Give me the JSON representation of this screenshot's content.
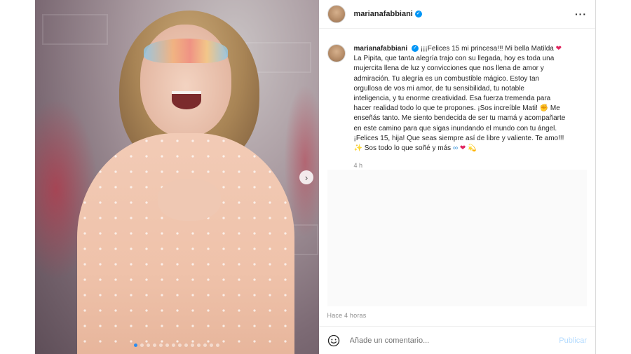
{
  "post": {
    "username": "marianafabbiani",
    "verified": true,
    "more_icon": "more-horizontal-icon",
    "caption_lines": [
      "¡¡¡Felices 15 mi princesa!!! Mi bella Matilda",
      "La Pipita, que tanta alegría trajo con su llegada, hoy es toda una",
      "mujercita llena de luz y convicciones que nos llena de amor y",
      "admiración. Tu alegría es un combustible mágico. Estoy tan",
      "orgullosa de vos mi amor, de tu sensibilidad, tu notable",
      "inteligencia, y tu enorme creatividad. Esa fuerza tremenda para",
      "hacer realidad todo lo que te propones. ¡Sos increíble Mati!",
      "Me",
      "enseñás tanto. Me siento bendecida de ser tu mamá y acompañarte",
      "en este camino para que sigas inundando el mundo con tu ángel.",
      "¡Felices 15, hija! Que seas siempre así de libre y valiente. Te amo!!!",
      "Sos todo lo que soñé y más"
    ],
    "emojis": {
      "heart": "❤",
      "fist": "✊",
      "sparkles": "✨",
      "infinity": "∞",
      "dizzy": "💫"
    },
    "caption_time": "4 h",
    "time_ago": "Hace 4 horas"
  },
  "media": {
    "next_icon": "chevron-right-icon",
    "carousel_count": 14,
    "carousel_active": 0
  },
  "comment_box": {
    "emoji_icon": "smiley-icon",
    "placeholder": "Añade un comentario...",
    "publish_label": "Publicar"
  },
  "colors": {
    "verified": "#0095f6",
    "publish_disabled": "#b3dbff",
    "heart": "#e0245e"
  }
}
